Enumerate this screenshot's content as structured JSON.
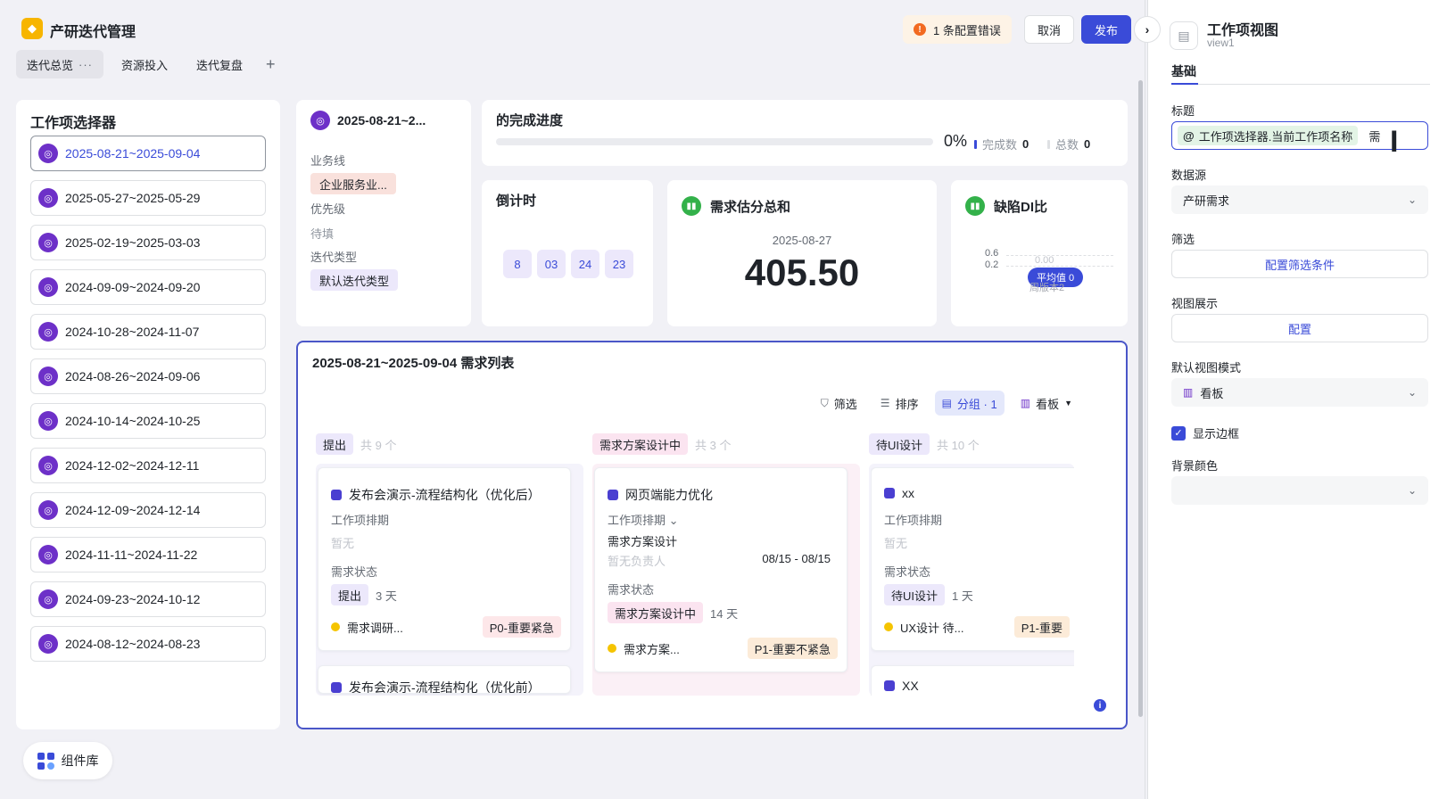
{
  "header": {
    "app_title": "产研迭代管理",
    "config_error": "1 条配置错误",
    "cancel_label": "取消",
    "publish_label": "发布",
    "tabs": [
      {
        "label": "迭代总览",
        "more": "···"
      },
      {
        "label": "资源投入"
      },
      {
        "label": "迭代复盘"
      }
    ],
    "add_tab": "+"
  },
  "selector": {
    "title": "工作项选择器",
    "items": [
      "2025-08-21~2025-09-04",
      "2025-05-27~2025-05-29",
      "2025-02-19~2025-03-03",
      "2024-09-09~2024-09-20",
      "2024-10-28~2024-11-07",
      "2024-08-26~2024-09-06",
      "2024-10-14~2024-10-25",
      "2024-12-02~2024-12-11",
      "2024-12-09~2024-12-14",
      "2024-11-11~2024-11-22",
      "2024-09-23~2024-10-12",
      "2024-08-12~2024-08-23"
    ],
    "active_index": 0
  },
  "info_card": {
    "title": "2025-08-21~2...",
    "business_line_label": "业务线",
    "business_line_value": "企业服务业...",
    "priority_label": "优先级",
    "priority_value": "待填",
    "iteration_type_label": "迭代类型",
    "iteration_type_value": "默认迭代类型"
  },
  "progress": {
    "title": "的完成进度",
    "percent": "0%",
    "done_label": "完成数",
    "done_value": "0",
    "total_label": "总数",
    "total_value": "0",
    "fill_fraction": 0
  },
  "countdown": {
    "title": "倒计时",
    "digits": [
      "8",
      "03",
      "24",
      "23"
    ]
  },
  "estimate": {
    "title": "需求估分总和",
    "date": "2025-08-27",
    "value": "405.50"
  },
  "defect": {
    "title": "缺陷DI比",
    "axis_top": "0.6",
    "axis_bottom": "0.2",
    "faded_value": "0.00",
    "avg_label": "平均值 0",
    "faded_label": "周版本2"
  },
  "list": {
    "title": "2025-08-21~2025-09-04 需求列表",
    "tools": {
      "filter": "筛选",
      "sort": "排序",
      "group": "分组 · 1",
      "view": "看板"
    },
    "columns": [
      {
        "name": "提出",
        "count": "共 9 个",
        "tag_color": "#ece8fb",
        "card": {
          "title": "发布会演示-流程结构化（优化后）",
          "schedule_label": "工作项排期",
          "schedule_value": "暂无",
          "status_label": "需求状态",
          "status_tag": "提出",
          "days": "3 天",
          "assignee": "需求调研...",
          "priority": "P0-重要紧急",
          "priority_color": "#fde7e9"
        },
        "next_card_title": "发布会演示-流程结构化（优化前）"
      },
      {
        "name": "需求方案设计中",
        "count": "共 3 个",
        "tag_color": "#fbe4f0",
        "card": {
          "title": "网页端能力优化",
          "schedule_label": "工作项排期",
          "schedule_stage": "需求方案设计",
          "schedule_owner": "暂无负责人",
          "schedule_dates": "08/15 - 08/15",
          "status_label": "需求状态",
          "status_tag": "需求方案设计中",
          "days": "14 天",
          "assignee": "需求方案...",
          "priority": "P1-重要不紧急",
          "priority_color": "#fcebd8"
        }
      },
      {
        "name": "待UI设计",
        "count": "共 10 个",
        "tag_color": "#ece8fb",
        "card": {
          "title": "xx",
          "schedule_label": "工作项排期",
          "schedule_value": "暂无",
          "status_label": "需求状态",
          "status_tag": "待UI设计",
          "days": "1 天",
          "assignee": "UX设计 待...",
          "priority": "P1-重要",
          "priority_color": "#fcebd8"
        },
        "next_card_title": "XX"
      }
    ]
  },
  "component_library": "组件库",
  "panel": {
    "title": "工作项视图",
    "subtitle": "view1",
    "tab": "基础",
    "title_label": "标题",
    "title_chip": "工作项选择器.当前工作项名称",
    "title_suffix": "需",
    "datasource_label": "数据源",
    "datasource_value": "产研需求",
    "filter_label": "筛选",
    "filter_button": "配置筛选条件",
    "display_label": "视图展示",
    "display_button": "配置",
    "mode_label": "默认视图模式",
    "mode_value": "看板",
    "show_border_label": "显示边框",
    "bg_color_label": "背景颜色"
  },
  "colors": {
    "accent": "#3a4bd8",
    "purple_icon": "#6d30c8",
    "green_icon": "#33b14a",
    "warning": "#f26a21"
  }
}
